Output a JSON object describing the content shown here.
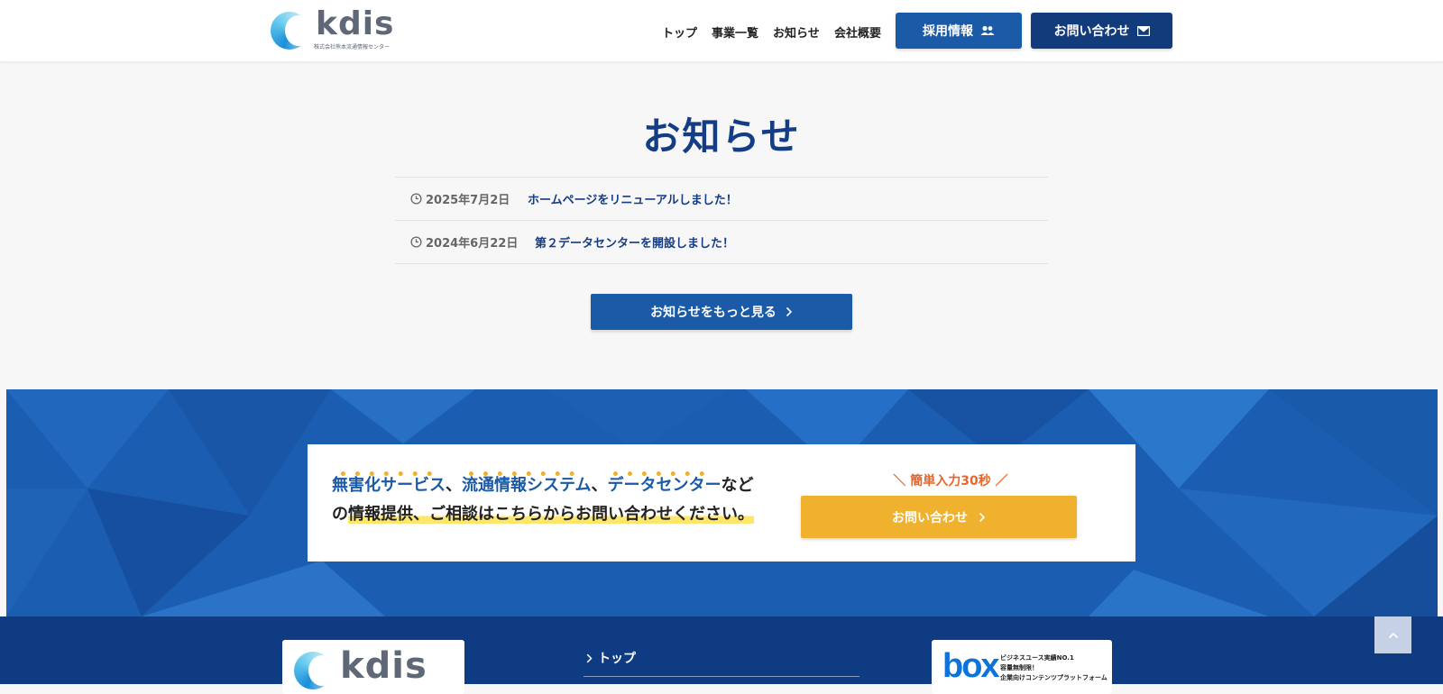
{
  "header": {
    "logo_text": "kdis",
    "logo_sub": "株式会社熊本流通情報センター",
    "nav": [
      {
        "label": "トップ"
      },
      {
        "label": "事業一覧"
      },
      {
        "label": "お知らせ"
      },
      {
        "label": "会社概要"
      }
    ],
    "recruit_label": "採用情報",
    "contact_label": "お問い合わせ"
  },
  "news": {
    "title": "お知らせ",
    "items": [
      {
        "date": "2025年7月2日",
        "text": "ホームページをリニューアルしました！"
      },
      {
        "date": "2024年6月22日",
        "text": "第２データセンターを開設しました！"
      }
    ],
    "more_label": "お知らせをもっと見る"
  },
  "cta": {
    "line1_part1": "無害化サービス",
    "sep1": "、",
    "line1_part2": "流通情報システム",
    "sep2": "、",
    "line1_part3": "データセンター",
    "line1_tail": "など",
    "line2_head": "の",
    "line2_highlight": "情報提供、ご相談はこちらからお問い合わせください。",
    "catch": "＼ 簡単入力30秒 ／",
    "button_label": "お問い合わせ"
  },
  "footer": {
    "logo_text": "kdis",
    "link_top": "トップ",
    "box_logo": "box",
    "box_caption": [
      "ビジネスユース実績NO.1",
      "容量無制限！",
      "企業向けコンテンツプラットフォーム"
    ]
  },
  "colors": {
    "primary": "#1a5aa6",
    "navy": "#123b7c",
    "title": "#153d85",
    "accent_yellow": "#f0b22e",
    "accent_orange": "#e6652c",
    "footer_bg": "#0f3b83"
  }
}
